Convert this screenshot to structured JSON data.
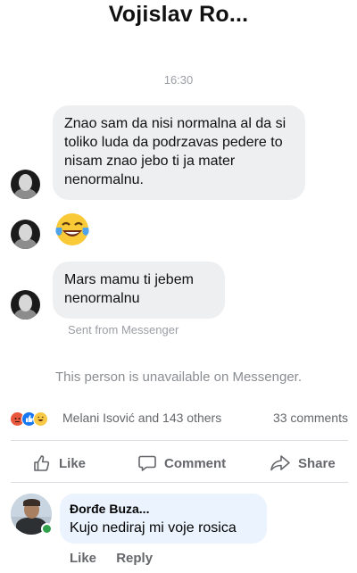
{
  "header": {
    "title": "Vojislav Ro..."
  },
  "chat": {
    "timestamp": "16:30",
    "messages": [
      {
        "type": "text",
        "text": "Znao sam da nisi normalna al da si toliko luda da podrzavas pedere to nisam znao jebo ti ja mater nenormalnu."
      },
      {
        "type": "emoji",
        "icon": "laughing-tears-emoji"
      },
      {
        "type": "text",
        "text": "Mars mamu ti jebem nenormalnu"
      }
    ],
    "sent_from": "Sent from Messenger",
    "unavailable_notice": "This person is unavailable on Messenger."
  },
  "post": {
    "reactions": [
      "angry-icon",
      "like-icon",
      "haha-icon"
    ],
    "reaction_summary": "Melani Isović and 143 others",
    "comments_count": "33 comments",
    "actions": {
      "like": "Like",
      "comment": "Comment",
      "share": "Share"
    }
  },
  "comment": {
    "author": "Đorđe Buza...",
    "text": "Kujo nediraj mi voje rosica",
    "like_label": "Like",
    "reply_label": "Reply"
  },
  "colors": {
    "bubble_grey": "#eeeff1",
    "comment_bubble": "#ebf3fe",
    "like_blue": "#1877f2",
    "online_green": "#31a24c",
    "muted_text": "#65676b"
  }
}
